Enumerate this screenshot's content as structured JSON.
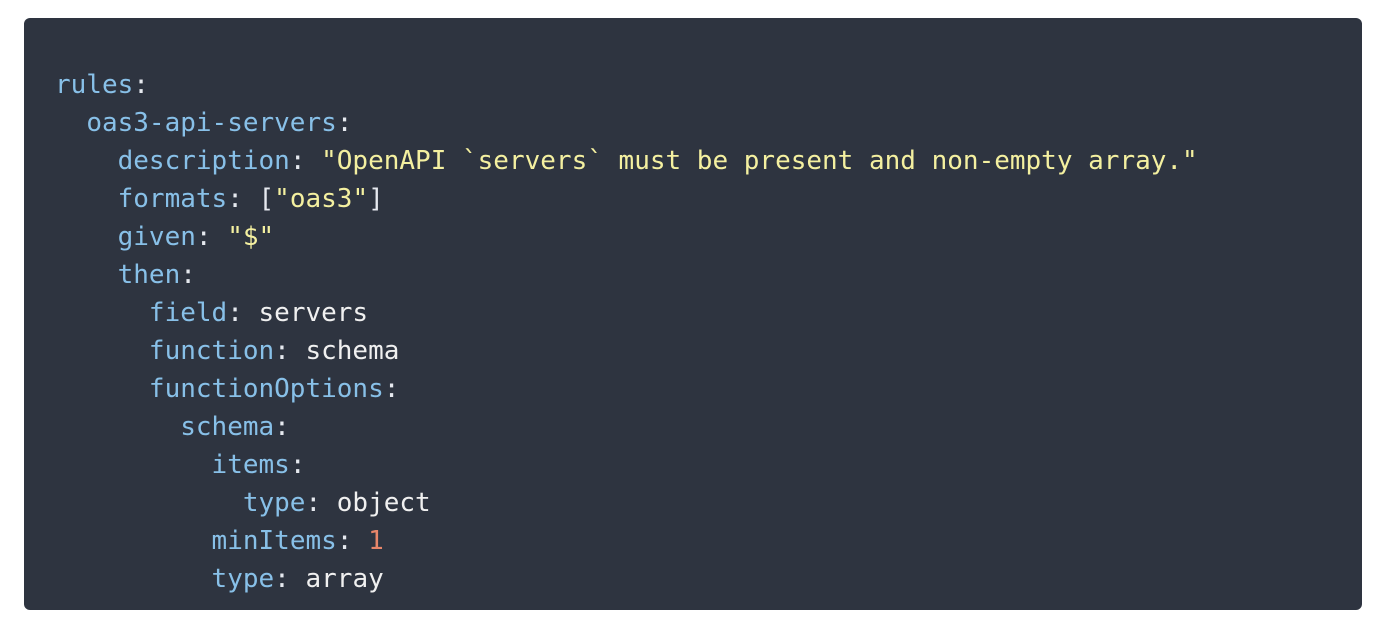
{
  "code": {
    "lines": [
      {
        "indent": "",
        "key": "rules",
        "sep": ":"
      },
      {
        "indent": "  ",
        "key": "oas3-api-servers",
        "sep": ":"
      },
      {
        "indent": "    ",
        "key": "description",
        "sep": ": ",
        "str": "\"OpenAPI `servers` must be present and non-empty array.\""
      },
      {
        "indent": "    ",
        "key": "formats",
        "sep": ": ",
        "open": "[",
        "str": "\"oas3\"",
        "close": "]"
      },
      {
        "indent": "    ",
        "key": "given",
        "sep": ": ",
        "str": "\"$\""
      },
      {
        "indent": "    ",
        "key": "then",
        "sep": ":"
      },
      {
        "indent": "      ",
        "key": "field",
        "sep": ": ",
        "plain": "servers"
      },
      {
        "indent": "      ",
        "key": "function",
        "sep": ": ",
        "plain": "schema"
      },
      {
        "indent": "      ",
        "key": "functionOptions",
        "sep": ":"
      },
      {
        "indent": "        ",
        "key": "schema",
        "sep": ":"
      },
      {
        "indent": "          ",
        "key": "items",
        "sep": ":"
      },
      {
        "indent": "            ",
        "key": "type",
        "sep": ": ",
        "plain": "object"
      },
      {
        "indent": "          ",
        "key": "minItems",
        "sep": ": ",
        "num": "1"
      },
      {
        "indent": "          ",
        "key": "type",
        "sep": ": ",
        "plain": "array"
      }
    ]
  }
}
